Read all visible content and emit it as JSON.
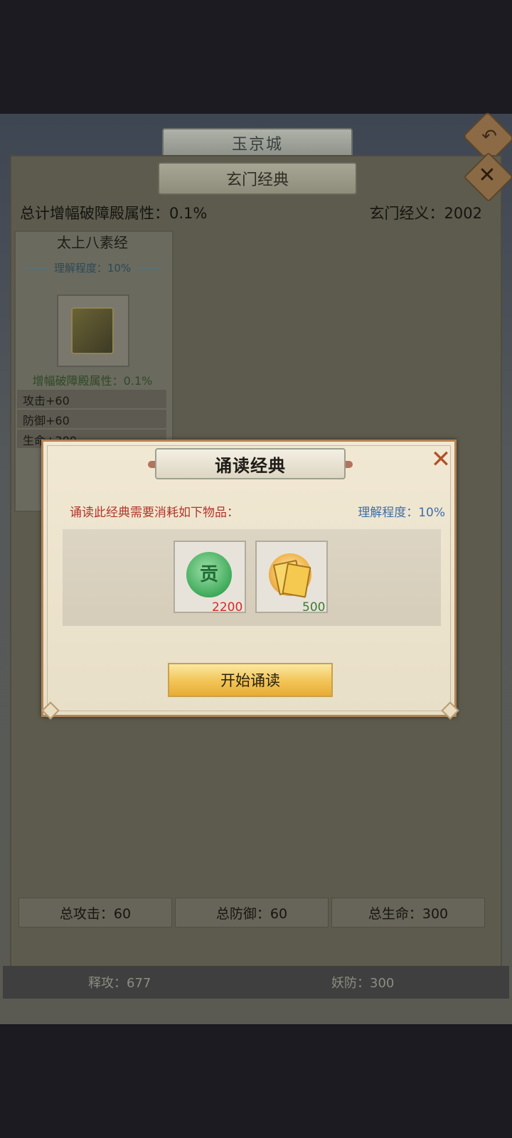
{
  "header": {
    "city_title": "玉京城"
  },
  "panel": {
    "title": "玄门经典",
    "total_bonus_label": "总计增幅破障殿属性：0.1%",
    "xuanmen_label": "玄门经义：2002"
  },
  "card": {
    "title": "太上八素经",
    "progress": "理解程度：10%",
    "bonus": "增幅破障殿属性：0.1%",
    "stats": [
      "攻击+60",
      "防御+60",
      "生命+300"
    ]
  },
  "totals": {
    "attack": "总攻击：60",
    "defense": "总防御：60",
    "life": "总生命：300"
  },
  "bottom": {
    "left": "释攻：677",
    "right": "妖防：300"
  },
  "dialog": {
    "title": "诵读经典",
    "cost_desc": "诵读此经典需要消耗如下物品：",
    "understand": "理解程度：10%",
    "items": [
      {
        "icon": "contribution-token-icon",
        "glyph": "贡",
        "count": "2200",
        "count_color": "#d62b26"
      },
      {
        "icon": "gold-cards-icon",
        "count": "500",
        "count_color": "#3f7a33"
      }
    ],
    "start_button": "开始诵读"
  }
}
